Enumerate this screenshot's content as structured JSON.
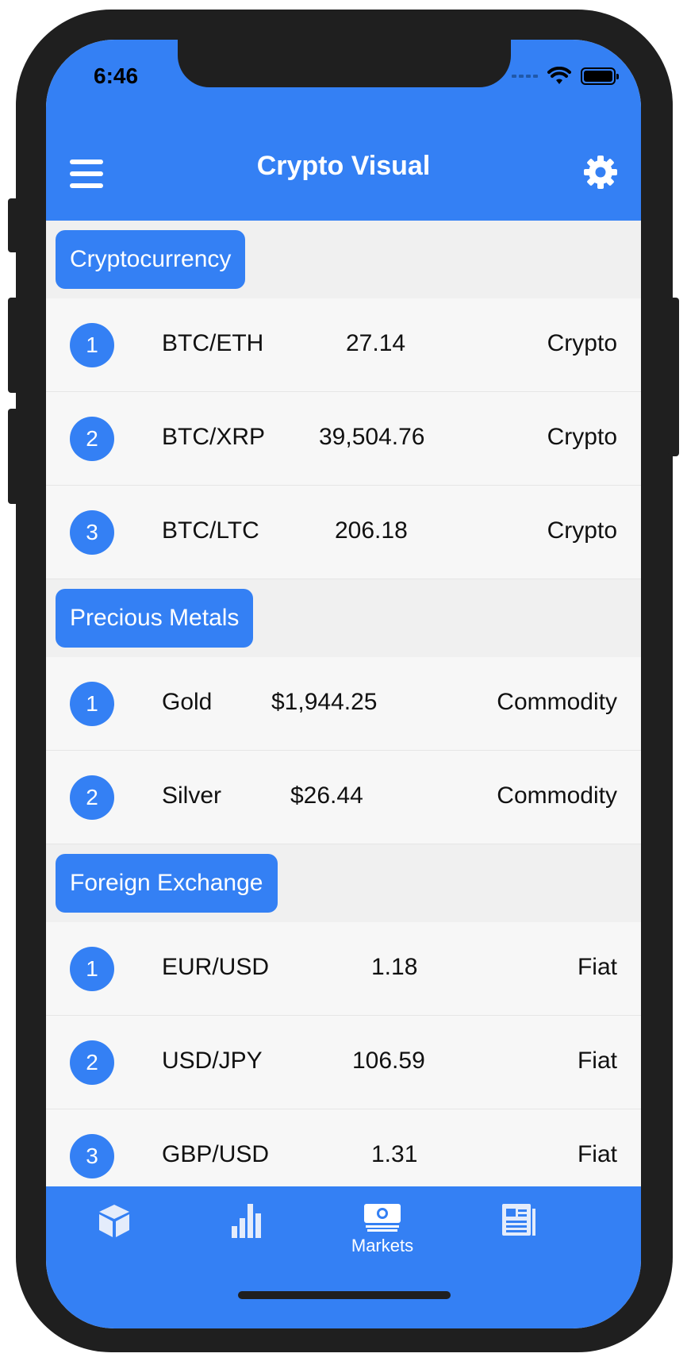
{
  "status": {
    "time": "6:46"
  },
  "header": {
    "title": "Crypto Visual",
    "menu_icon": "menu-icon",
    "settings_icon": "gear-icon"
  },
  "sections": [
    {
      "title": "Cryptocurrency",
      "rows": [
        {
          "rank": "1",
          "pair": "BTC/ETH",
          "price": "27.14",
          "type": "Crypto"
        },
        {
          "rank": "2",
          "pair": "BTC/XRP",
          "price": "39,504.76",
          "type": "Crypto"
        },
        {
          "rank": "3",
          "pair": "BTC/LTC",
          "price": "206.18",
          "type": "Crypto"
        }
      ]
    },
    {
      "title": "Precious Metals",
      "rows": [
        {
          "rank": "1",
          "pair": "Gold",
          "price": "$1,944.25",
          "type": "Commodity"
        },
        {
          "rank": "2",
          "pair": "Silver",
          "price": "$26.44",
          "type": "Commodity"
        }
      ]
    },
    {
      "title": "Foreign Exchange",
      "rows": [
        {
          "rank": "1",
          "pair": "EUR/USD",
          "price": "1.18",
          "type": "Fiat"
        },
        {
          "rank": "2",
          "pair": "USD/JPY",
          "price": "106.59",
          "type": "Fiat"
        },
        {
          "rank": "3",
          "pair": "GBP/USD",
          "price": "1.31",
          "type": "Fiat"
        }
      ]
    }
  ],
  "tabs": [
    {
      "icon": "cube-icon",
      "label": ""
    },
    {
      "icon": "bar-chart-icon",
      "label": ""
    },
    {
      "icon": "money-icon",
      "label": "Markets",
      "active": true
    },
    {
      "icon": "newspaper-icon",
      "label": ""
    }
  ],
  "colors": {
    "accent": "#3480f4",
    "row_bg": "#f7f7f7",
    "section_bg": "#f0f0f0"
  }
}
